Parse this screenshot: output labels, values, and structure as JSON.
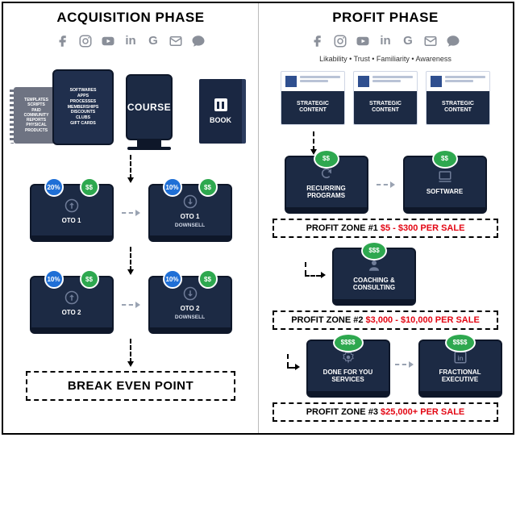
{
  "acquisition": {
    "title": "ACQUISITION PHASE",
    "notebook": "TEMPLATES\nSCRIPTS\nPAID\nCOMMUNITY\nREPORTS\nPHYSICAL\nPRODUCTS",
    "tablet": "SOFTWARES\nAPPS\nPROCESSES\nMEMBERSHIPS\nDISCOUNTS\nCLUBS\nGIFT CARDS",
    "monitor": "COURSE",
    "book": "BOOK",
    "oto1": {
      "label": "OTO 1",
      "pct": "20%",
      "cash": "$$"
    },
    "oto1ds": {
      "label": "OTO 1",
      "sub": "DOWNSELL",
      "pct": "10%",
      "cash": "$$"
    },
    "oto2": {
      "label": "OTO 2",
      "pct": "10%",
      "cash": "$$"
    },
    "oto2ds": {
      "label": "OTO 2",
      "sub": "DOWNSELL",
      "pct": "10%",
      "cash": "$$"
    },
    "breakeven": "BREAK EVEN POINT"
  },
  "profit": {
    "title": "PROFIT PHASE",
    "subline": "Likability • Trust • Familiarity • Awareness",
    "card": "STRATEGIC CONTENT",
    "recurring": {
      "label": "RECURRING PROGRAMS",
      "cash": "$$"
    },
    "software": {
      "label": "SOFTWARE",
      "cash": "$$"
    },
    "pz1": {
      "label": "PROFIT ZONE #1",
      "val": "$5 - $300 PER SALE"
    },
    "coaching": {
      "label": "COACHING & CONSULTING",
      "cash": "$$$"
    },
    "pz2": {
      "label": "PROFIT ZONE #2",
      "val": "$3,000 - $10,000 PER SALE"
    },
    "dfy": {
      "label": "DONE FOR YOU SERVICES",
      "cash": "$$$$"
    },
    "frac": {
      "label": "FRACTIONAL EXECUTIVE",
      "cash": "$$$$"
    },
    "pz3": {
      "label": "PROFIT ZONE #3",
      "val": "$25,000+ PER SALE"
    }
  }
}
